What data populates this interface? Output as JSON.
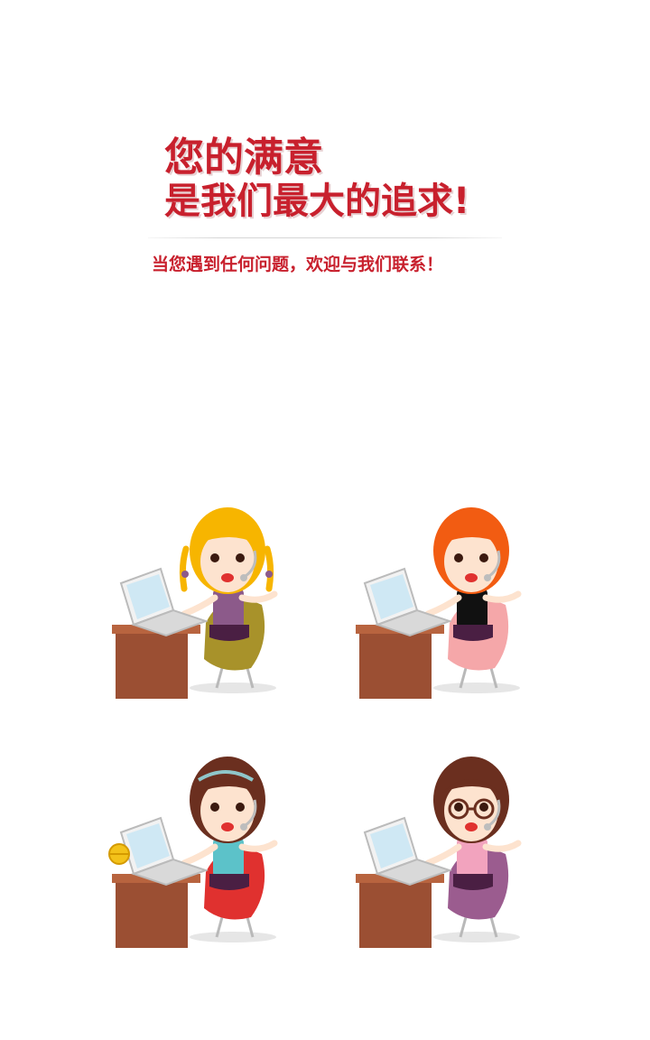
{
  "headline": {
    "line1": "您的满意",
    "line2": "是我们最大的追求!"
  },
  "subline": "当您遇到任何问题，欢迎与我们联系！",
  "colors": {
    "accent": "#c8202d",
    "desk": "#9b4f33",
    "laptop_screen": "#cfe8f4"
  },
  "agents": [
    {
      "icon": "support-agent-blonde-braids-icon",
      "hair": "#f7b500",
      "top": "#8c5a8a",
      "chair": "#a8922a"
    },
    {
      "icon": "support-agent-orange-hair-icon",
      "hair": "#f25c12",
      "top": "#111111",
      "chair": "#f5a7a9"
    },
    {
      "icon": "support-agent-headband-icon",
      "hair": "#6b2f1f",
      "top": "#5cc2c9",
      "chair": "#e0312f"
    },
    {
      "icon": "support-agent-glasses-icon",
      "hair": "#6b2f1f",
      "top": "#f2a3be",
      "chair": "#9b5c8f"
    }
  ]
}
